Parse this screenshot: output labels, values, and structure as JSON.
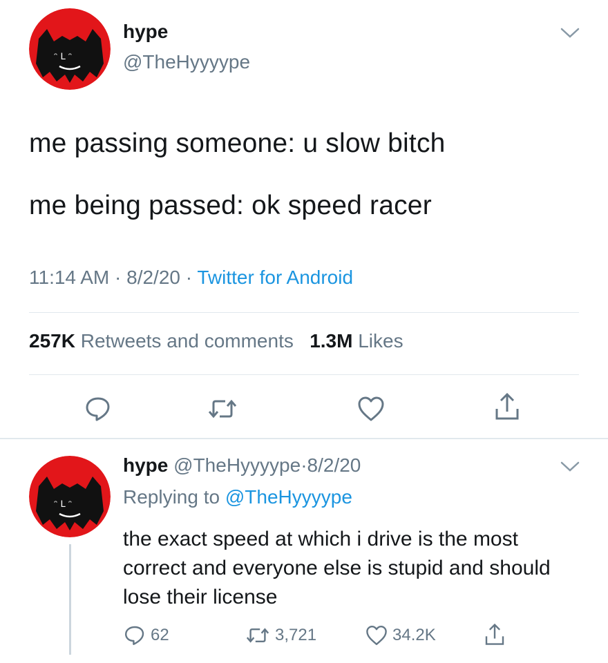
{
  "main_tweet": {
    "display_name": "hype",
    "handle": "@TheHyyyype",
    "lines": [
      "me passing someone: u slow bitch",
      "me being passed: ok speed racer"
    ],
    "time": "11:14 AM",
    "separator": "·",
    "date": "8/2/20",
    "source": "Twitter for Android",
    "retweets_count": "257K",
    "retweets_label": "Retweets and comments",
    "likes_count": "1.3M",
    "likes_label": "Likes",
    "actions": [
      "reply-icon",
      "retweet-icon",
      "like-icon",
      "share-icon"
    ]
  },
  "reply_tweet": {
    "display_name": "hype",
    "handle": "@TheHyyyype",
    "separator": "·",
    "date": "8/2/20",
    "replying_label": "Replying to",
    "replying_to": "@TheHyyyype",
    "text": "the exact speed at which i drive is the most correct and everyone else is stupid and should lose their license",
    "reply_count": "62",
    "retweet_count": "3,721",
    "like_count": "34.2K"
  },
  "colors": {
    "text": "#14171a",
    "muted": "#657786",
    "link": "#1b95e0",
    "divider": "#e1e8ed",
    "avatar_bg": "#e2161a"
  }
}
